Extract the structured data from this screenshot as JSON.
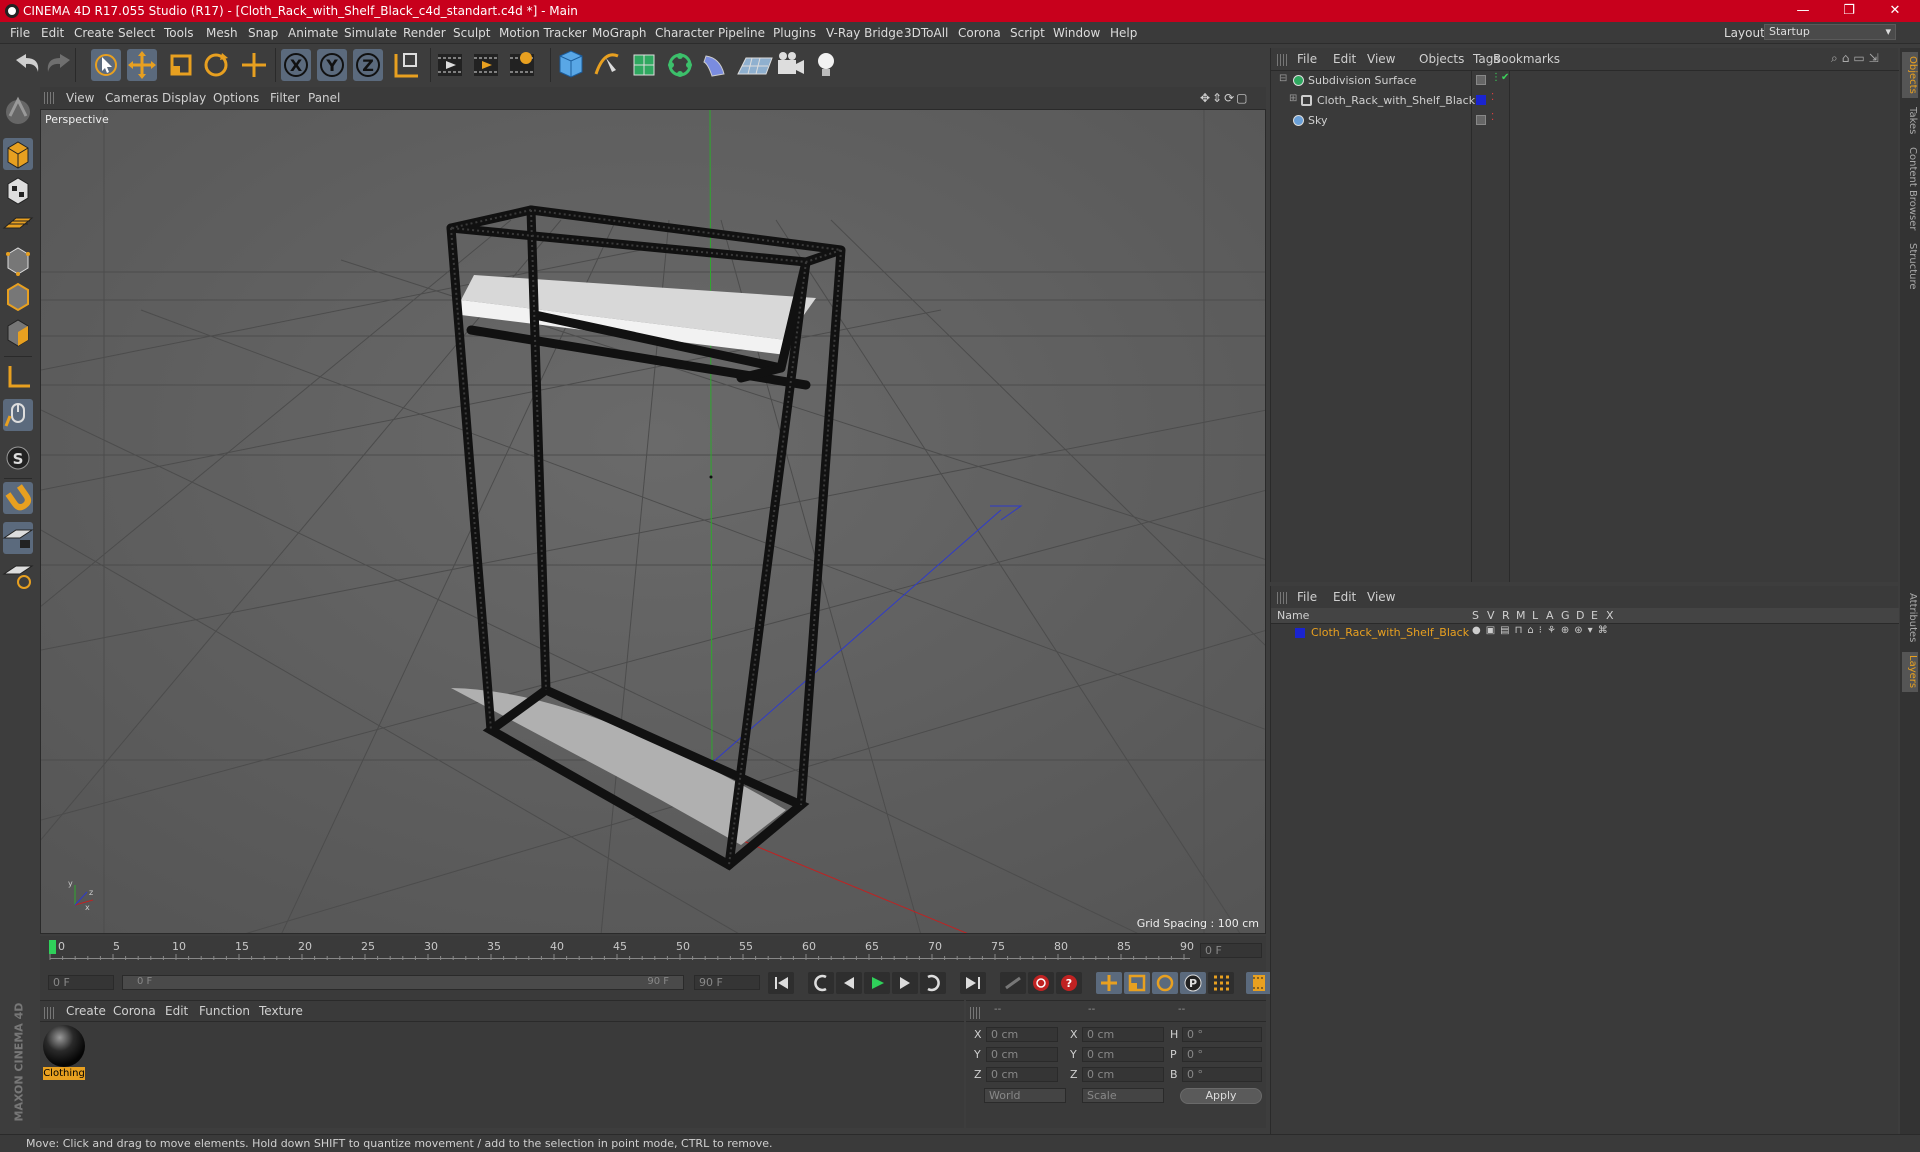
{
  "window": {
    "title": "CINEMA 4D R17.055 Studio (R17) - [Cloth_Rack_with_Shelf_Black_c4d_standart.c4d *] - Main",
    "minimize": "—",
    "maximize": "❐",
    "close": "✕"
  },
  "menu": [
    "File",
    "Edit",
    "Create",
    "Select",
    "Tools",
    "Mesh",
    "Snap",
    "Animate",
    "Simulate",
    "Render",
    "Sculpt",
    "Motion Tracker",
    "MoGraph",
    "Character",
    "Pipeline",
    "Plugins",
    "V-Ray Bridge",
    "3DToAll",
    "Corona",
    "Script",
    "Window",
    "Help"
  ],
  "layout": {
    "label": "Layout:",
    "value": "Startup"
  },
  "viewport": {
    "menu": [
      "View",
      "Cameras",
      "Display",
      "Options",
      "Filter",
      "Panel"
    ],
    "name": "Perspective",
    "grid_spacing": "Grid Spacing : 100 cm"
  },
  "timeline": {
    "ticks": [
      "0",
      "5",
      "10",
      "15",
      "20",
      "25",
      "30",
      "35",
      "40",
      "45",
      "50",
      "55",
      "60",
      "65",
      "70",
      "75",
      "80",
      "85",
      "90"
    ],
    "current_frame": "0 F",
    "start": "0 F",
    "range_start": "0 F",
    "range_end": "90 F",
    "end": "90 F"
  },
  "material_panel": {
    "menu": [
      "Create",
      "Corona",
      "Edit",
      "Function",
      "Texture"
    ],
    "materials": [
      {
        "name": "Clothing"
      }
    ]
  },
  "coords": {
    "headers": [
      "--",
      "--",
      "--"
    ],
    "rows": [
      {
        "a": "X",
        "av": "0 cm",
        "b": "X",
        "bv": "0 cm",
        "c": "H",
        "cv": "0 °"
      },
      {
        "a": "Y",
        "av": "0 cm",
        "b": "Y",
        "bv": "0 cm",
        "c": "P",
        "cv": "0 °"
      },
      {
        "a": "Z",
        "av": "0 cm",
        "b": "Z",
        "bv": "0 cm",
        "c": "B",
        "cv": "0 °"
      }
    ],
    "space": "World",
    "mode": "Scale",
    "apply": "Apply"
  },
  "object_manager": {
    "menu": [
      "File",
      "Edit",
      "View",
      "Objects",
      "Tags",
      "Bookmarks"
    ],
    "objects": [
      {
        "name": "Subdivision Surface",
        "icon": "subdivision-icon"
      },
      {
        "name": "Cloth_Rack_with_Shelf_Black",
        "icon": "null-object-icon"
      },
      {
        "name": "Sky",
        "icon": "sky-icon"
      }
    ]
  },
  "layer_manager": {
    "menu": [
      "File",
      "Edit",
      "View"
    ],
    "columns": [
      "Name",
      "S",
      "V",
      "R",
      "M",
      "L",
      "A",
      "G",
      "D",
      "E",
      "X"
    ],
    "layers": [
      {
        "name": "Cloth_Rack_with_Shelf_Black",
        "color": "#1a24d0"
      }
    ]
  },
  "right_tabs": [
    "Objects",
    "Takes",
    "Content Browser",
    "Structure",
    "Attributes",
    "Layers"
  ],
  "status": "Move: Click and drag to move elements. Hold down SHIFT to quantize movement / add to the selection in point mode, CTRL to remove.",
  "brand": "MAXON CINEMA 4D",
  "colors": {
    "title_bar": "#c8001c",
    "selected_tool": "#5b6a7d",
    "accent_orange": "#e8a020",
    "layer_blue": "#1a24d0"
  }
}
